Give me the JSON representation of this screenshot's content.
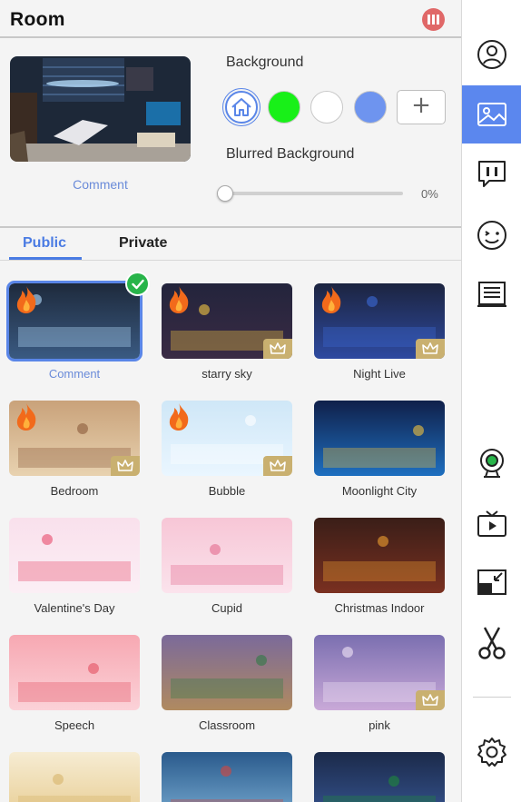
{
  "header": {
    "title": "Room",
    "logo_icon": "brand-logo-icon"
  },
  "preview": {
    "caption": "Comment"
  },
  "background": {
    "label": "Background",
    "swatches": [
      {
        "name": "home",
        "color": "#ffffff",
        "icon": "home-icon",
        "selected": true
      },
      {
        "name": "green",
        "color": "#18f018"
      },
      {
        "name": "white",
        "color": "#ffffff"
      },
      {
        "name": "blue",
        "color": "#6e94ef"
      }
    ],
    "add_label": "+"
  },
  "blur": {
    "label": "Blurred Background",
    "value": "0%",
    "level": 0
  },
  "tabs": [
    {
      "label": "Public",
      "active": true
    },
    {
      "label": "Private",
      "active": false
    }
  ],
  "scenes": [
    {
      "label": "Comment",
      "hot": true,
      "premium": false,
      "selected": true
    },
    {
      "label": "starry sky",
      "hot": true,
      "premium": true
    },
    {
      "label": "Night Live",
      "hot": true,
      "premium": true
    },
    {
      "label": "Bedroom",
      "hot": true,
      "premium": true
    },
    {
      "label": "Bubble",
      "hot": true,
      "premium": true
    },
    {
      "label": "Moonlight City",
      "hot": false,
      "premium": false
    },
    {
      "label": "Valentine's Day",
      "hot": false,
      "premium": false
    },
    {
      "label": "Cupid",
      "hot": false,
      "premium": false
    },
    {
      "label": "Christmas Indoor",
      "hot": false,
      "premium": false
    },
    {
      "label": "Speech",
      "hot": false,
      "premium": false
    },
    {
      "label": "Classroom",
      "hot": false,
      "premium": false
    },
    {
      "label": "pink",
      "hot": false,
      "premium": true
    },
    {
      "label": "",
      "hot": false,
      "premium": false
    },
    {
      "label": "",
      "hot": false,
      "premium": false
    },
    {
      "label": "",
      "hot": false,
      "premium": false
    }
  ],
  "sidebar": [
    {
      "name": "profile",
      "icon": "user-icon"
    },
    {
      "name": "background",
      "icon": "image-icon",
      "active": true
    },
    {
      "name": "chat",
      "icon": "chat-icon"
    },
    {
      "name": "emoji",
      "icon": "emoji-icon"
    },
    {
      "name": "list",
      "icon": "list-icon"
    },
    {
      "name": "camera",
      "icon": "webcam-icon"
    },
    {
      "name": "video",
      "icon": "tv-play-icon"
    },
    {
      "name": "pip",
      "icon": "pip-icon"
    },
    {
      "name": "cut",
      "icon": "scissors-icon"
    },
    {
      "name": "settings",
      "icon": "gear-icon"
    }
  ],
  "colors": {
    "accent": "#5b87ee",
    "selected_text": "#6a8bd9",
    "crown": "#c9b070",
    "check": "#28b44a",
    "logo": "#e06868"
  }
}
